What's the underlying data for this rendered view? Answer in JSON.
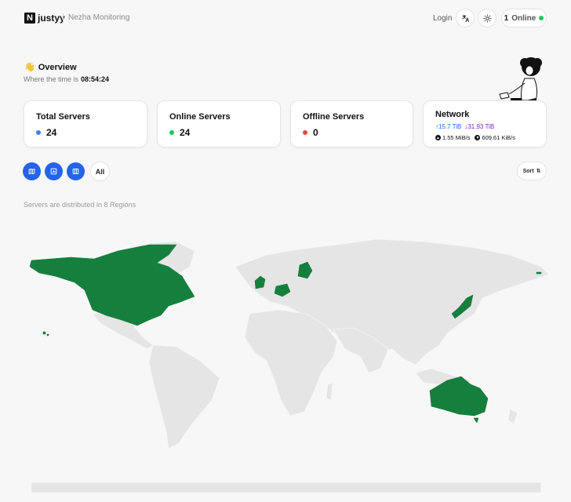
{
  "header": {
    "logo_letter": "N",
    "brand": "justyy",
    "subtitle": "Nezha Monitoring",
    "login_label": "Login",
    "online_count": "1",
    "online_label": "Online"
  },
  "overview": {
    "title": "Overview",
    "emoji": "👋",
    "time_label": "Where the time is",
    "time_value": "08:54:24"
  },
  "cards": {
    "total": {
      "title": "Total Servers",
      "value": "24",
      "dot_color": "#3b82f6"
    },
    "online": {
      "title": "Online Servers",
      "value": "24",
      "dot_color": "#22c55e"
    },
    "offline": {
      "title": "Offline Servers",
      "value": "0",
      "dot_color": "#ef4444"
    },
    "network": {
      "title": "Network",
      "upload_total": "↑15.7 TiB",
      "download_total": "↓31.93 TiB",
      "upload_speed": "1.55 MiB/s",
      "download_speed": "609.61 KiB/s"
    }
  },
  "toolbar": {
    "all_label": "All",
    "sort_label": "Sort"
  },
  "regions_text": "Servers are distributed in 8 Regions",
  "colors": {
    "accent": "#2563eb",
    "map_active": "#15803d",
    "map_inactive": "#e5e5e5"
  }
}
